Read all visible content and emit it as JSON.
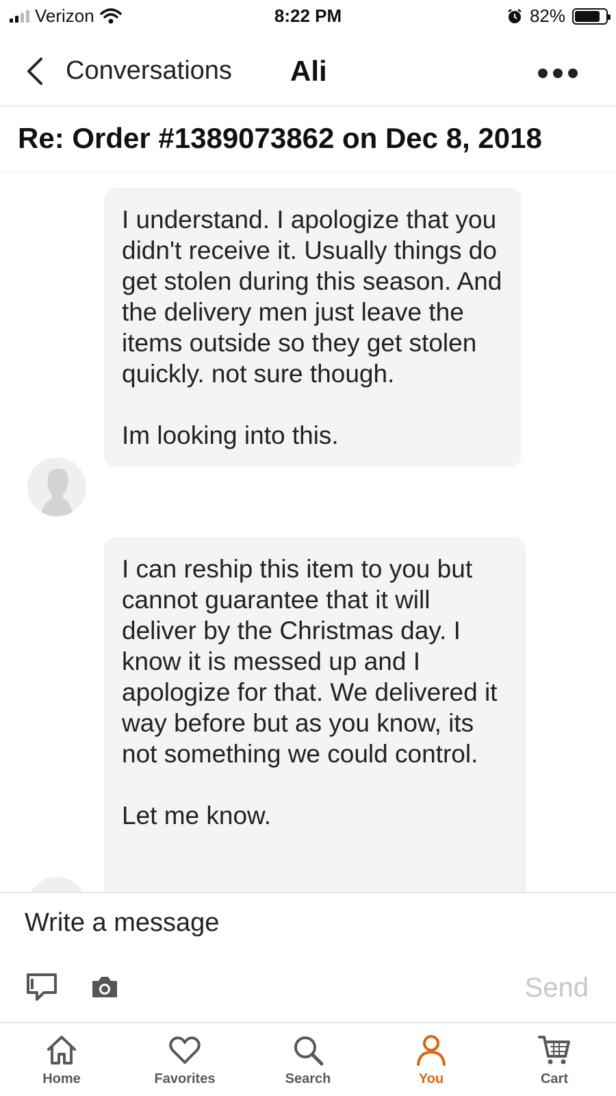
{
  "status_bar": {
    "carrier": "Verizon",
    "time": "8:22 PM",
    "battery": "82%",
    "battery_level": 0.82
  },
  "header": {
    "back_label": "Conversations",
    "title": "Ali"
  },
  "subject": "Re: Order #1389073862 on Dec 8, 2018",
  "messages": [
    {
      "text": "I understand. I apologize that you didn't receive it. Usually things do get stolen during this season. And the delivery men just leave the items outside so they get stolen quickly. not sure though.\n\nIm looking into this."
    },
    {
      "text": "I can reship this item to you but cannot guarantee that it will deliver by the Christmas day. I know it is messed up and I apologize for that. We delivered it way before but as you know, its not something we could control.\n\nLet me know."
    }
  ],
  "composer": {
    "placeholder": "Write a message",
    "send_label": "Send"
  },
  "tabs": [
    {
      "label": "Home",
      "icon": "home-icon"
    },
    {
      "label": "Favorites",
      "icon": "heart-icon"
    },
    {
      "label": "Search",
      "icon": "search-icon"
    },
    {
      "label": "You",
      "icon": "user-icon",
      "active": true
    },
    {
      "label": "Cart",
      "icon": "cart-icon"
    }
  ],
  "colors": {
    "accent": "#e0650e",
    "bubble": "#f4f4f4"
  }
}
